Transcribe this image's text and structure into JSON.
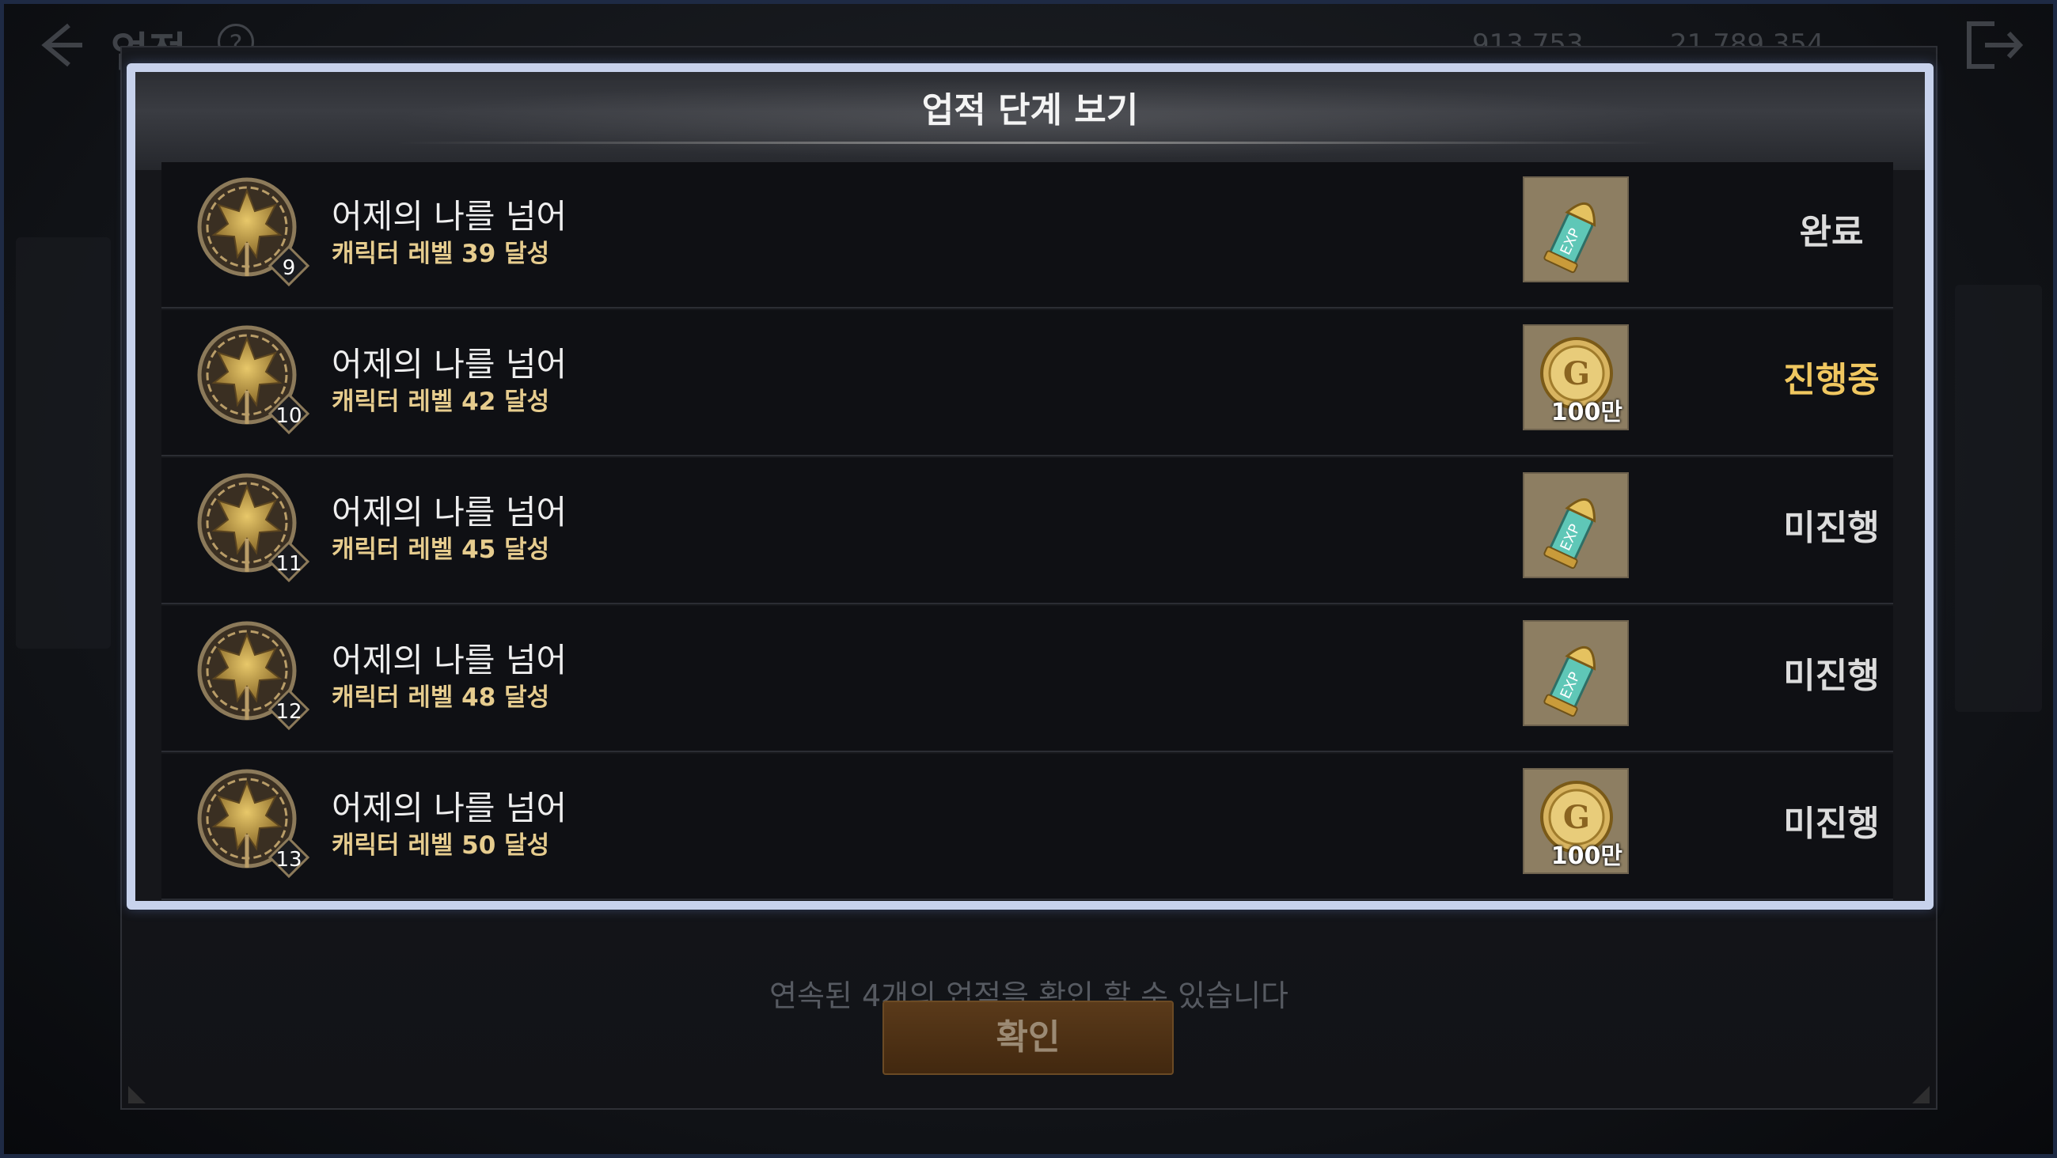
{
  "background": {
    "title": "업적",
    "currency_1": "913,753",
    "currency_2": "21,789,354"
  },
  "dialog": {
    "title": "업적 단계 보기",
    "hint": "연속된 4개의 업적을 확인 할 수 있습니다",
    "confirm_label": "확인"
  },
  "colors": {
    "panel_border": "#c7d2ec",
    "status_active": "#f0c760",
    "subtitle": "#e6cc8e"
  },
  "rows": [
    {
      "title": "어제의 나를 넘어",
      "subtitle": "캐릭터 레벨 39 달성",
      "stage": "9",
      "reward_icon": "exp-potion-icon",
      "reward_amount": "",
      "status": "완료"
    },
    {
      "title": "어제의 나를 넘어",
      "subtitle": "캐릭터 레벨 42 달성",
      "stage": "10",
      "reward_icon": "gold-coin-icon",
      "reward_amount": "100만",
      "status": "진행중"
    },
    {
      "title": "어제의 나를 넘어",
      "subtitle": "캐릭터 레벨 45 달성",
      "stage": "11",
      "reward_icon": "exp-potion-icon",
      "reward_amount": "",
      "status": "미진행"
    },
    {
      "title": "어제의 나를 넘어",
      "subtitle": "캐릭터 레벨 48 달성",
      "stage": "12",
      "reward_icon": "exp-potion-icon",
      "reward_amount": "",
      "status": "미진행"
    },
    {
      "title": "어제의 나를 넘어",
      "subtitle": "캐릭터 레벨 50 달성",
      "stage": "13",
      "reward_icon": "gold-coin-icon",
      "reward_amount": "100만",
      "status": "미진행"
    }
  ]
}
